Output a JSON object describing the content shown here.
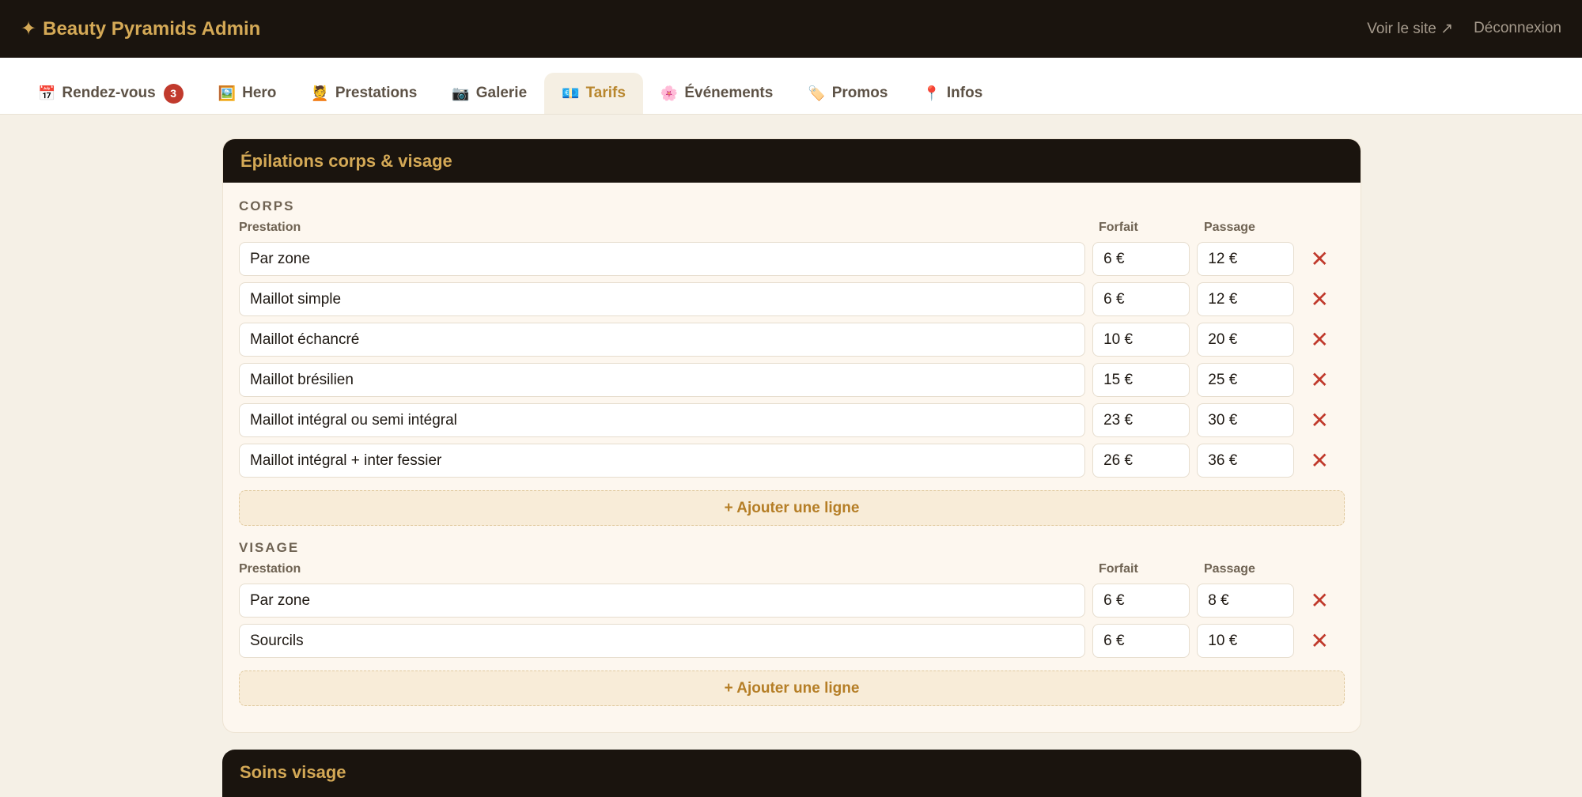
{
  "topbar": {
    "brand_star": "✦",
    "brand": "Beauty Pyramids Admin",
    "voir_site": "Voir le site ↗",
    "logout": "Déconnexion"
  },
  "tabs": [
    {
      "icon": "📅",
      "label": "Rendez-vous",
      "badge": "3",
      "active": false
    },
    {
      "icon": "🖼️",
      "label": "Hero",
      "active": false
    },
    {
      "icon": "💆",
      "label": "Prestations",
      "active": false
    },
    {
      "icon": "📷",
      "label": "Galerie",
      "active": false
    },
    {
      "icon": "💶",
      "label": "Tarifs",
      "active": true
    },
    {
      "icon": "🌸",
      "label": "Événements",
      "active": false
    },
    {
      "icon": "🏷️",
      "label": "Promos",
      "active": false
    },
    {
      "icon": "📍",
      "label": "Infos",
      "active": false
    }
  ],
  "card": {
    "title": "Épilations corps & visage",
    "col_prestation": "Prestation",
    "col_forfait": "Forfait",
    "col_passage": "Passage",
    "add_line": "+ Ajouter une ligne",
    "delete_glyph": "✕",
    "sections": [
      {
        "title": "CORPS",
        "rows": [
          {
            "name": "Par zone",
            "forfait": "6 €",
            "passage": "12 €"
          },
          {
            "name": "Maillot simple",
            "forfait": "6 €",
            "passage": "12 €"
          },
          {
            "name": "Maillot échancré",
            "forfait": "10 €",
            "passage": "20 €"
          },
          {
            "name": "Maillot brésilien",
            "forfait": "15 €",
            "passage": "25 €"
          },
          {
            "name": "Maillot intégral ou semi intégral",
            "forfait": "23 €",
            "passage": "30 €"
          },
          {
            "name": "Maillot intégral + inter fessier",
            "forfait": "26 €",
            "passage": "36 €"
          }
        ]
      },
      {
        "title": "VISAGE",
        "rows": [
          {
            "name": "Par zone",
            "forfait": "6 €",
            "passage": "8 €"
          },
          {
            "name": "Sourcils",
            "forfait": "6 €",
            "passage": "10 €"
          }
        ]
      }
    ]
  },
  "next_card": {
    "title": "Soins visage"
  },
  "colors": {
    "topbar_bg": "#1a140e",
    "accent_gold": "#d4a956",
    "active_tab": "#b8862d",
    "badge_red": "#c13a2d",
    "delete_red": "#c0392b"
  }
}
